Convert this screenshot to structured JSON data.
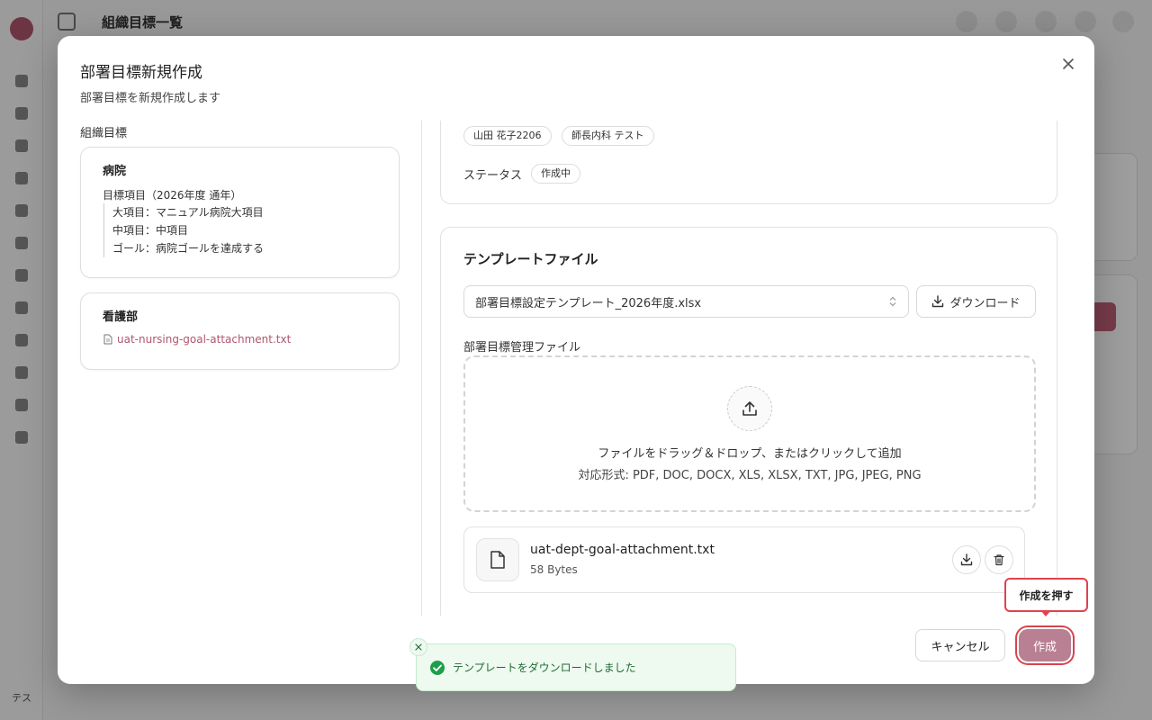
{
  "background": {
    "page_title": "組織目標一覧",
    "user_initials": "テス"
  },
  "modal": {
    "title": "部署目標新規作成",
    "description": "部署目標を新規作成します",
    "close_icon": "close-icon"
  },
  "left": {
    "section_label": "組織目標",
    "hospital_card": {
      "title": "病院",
      "goal_header": "目標項目（2026年度 通年）",
      "lines": [
        "大項目：マニュアル病院大項目",
        "中項目：中項目",
        "ゴール：病院ゴールを達成する"
      ]
    },
    "nursing_card": {
      "title": "看護部",
      "attachment": "uat-nursing-goal-attachment.txt"
    }
  },
  "info": {
    "chips": [
      "山田 花子2206",
      "師長内科 テスト"
    ],
    "status_label": "ステータス",
    "status_value": "作成中"
  },
  "template": {
    "title": "テンプレートファイル",
    "selected": "部署目標設定テンプレート_2026年度.xlsx",
    "download_label": "ダウンロード",
    "mgmt_label": "部署目標管理ファイル",
    "drop_main": "ファイルをドラッグ＆ドロップ、またはクリックして追加",
    "drop_sub": "対応形式: PDF, DOC, DOCX, XLS, XLSX, TXT, JPG, JPEG, PNG",
    "file": {
      "name": "uat-dept-goal-attachment.txt",
      "size": "58 Bytes"
    }
  },
  "footer": {
    "cancel_label": "キャンセル",
    "create_label": "作成"
  },
  "callout": "作成を押す",
  "toast": {
    "message": "テンプレートをダウンロードしました"
  },
  "colors": {
    "accent": "#b0566e",
    "primary_button": "#b88092",
    "toast_bg": "#eef9f0",
    "toast_text": "#1f6b33",
    "callout_border": "#e0424e"
  }
}
